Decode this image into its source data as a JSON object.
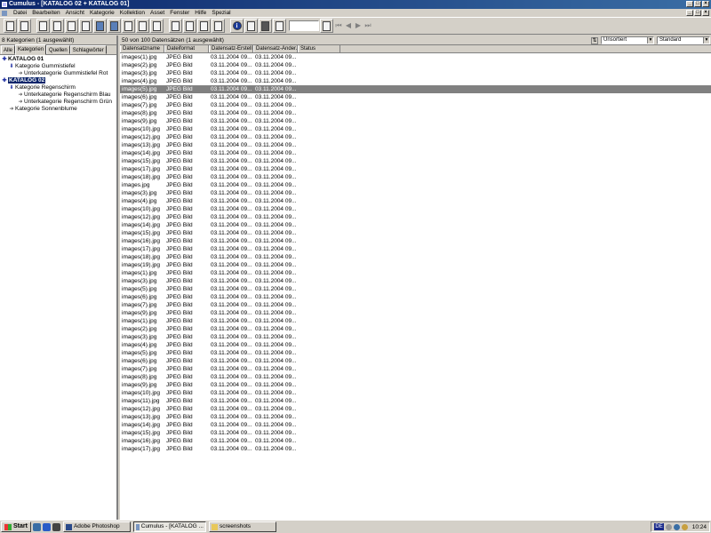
{
  "window": {
    "title": "Cumulus - [KATALOG 02 + KATALOG 01]",
    "controls": [
      "_",
      "□",
      "×"
    ]
  },
  "menubar": {
    "items": [
      "Datei",
      "Bearbeiten",
      "Ansicht",
      "Kategorie",
      "Kollektion",
      "Asset",
      "Fenster",
      "Hilfe",
      "Spezial"
    ]
  },
  "left": {
    "status": "8 Kategorien (1 ausgewählt)",
    "tabs": [
      "Alle",
      "Kategorien",
      "Quellen",
      "Schlagwörter"
    ],
    "active_tab": "Kategorien",
    "tree": [
      {
        "label": "KATALOG 01",
        "level": 0,
        "selected": false
      },
      {
        "label": "Kategorie Gummistiefel",
        "level": 1,
        "selected": false
      },
      {
        "label": "Unterkategorie Gummistiefel Rot",
        "level": 2,
        "selected": false
      },
      {
        "label": "KATALOG 02",
        "level": 0,
        "selected": true
      },
      {
        "label": "Kategorie Regenschirm",
        "level": 1,
        "selected": false
      },
      {
        "label": "Unterkategorie Regenschirm Blau",
        "level": 2,
        "selected": false
      },
      {
        "label": "Unterkategorie Regenschirm Grün",
        "level": 2,
        "selected": false
      },
      {
        "label": "Kategorie Sonnenblume",
        "level": 1,
        "selected": false
      }
    ]
  },
  "right": {
    "status": "50 von 100 Datensätzen (1 ausgewählt)",
    "sort_value": "Unsortiert",
    "view_value": "Standard",
    "columns": [
      "Datensatzname",
      "Dateiformat",
      "Datensatz-Erstell...",
      "Datensatz-Änder...",
      "Status"
    ],
    "rows": [
      [
        "images(1).jpg",
        "JPEG Bild",
        "03.11.2004 09...",
        "03.11.2004 09..."
      ],
      [
        "images(2).jpg",
        "JPEG Bild",
        "03.11.2004 09...",
        "03.11.2004 09..."
      ],
      [
        "images(3).jpg",
        "JPEG Bild",
        "03.11.2004 09...",
        "03.11.2004 09..."
      ],
      [
        "images(4).jpg",
        "JPEG Bild",
        "03.11.2004 09...",
        "03.11.2004 09..."
      ],
      [
        "images(5).jpg",
        "JPEG Bild",
        "03.11.2004 09...",
        "03.11.2004 09..."
      ],
      [
        "images(6).jpg",
        "JPEG Bild",
        "03.11.2004 09...",
        "03.11.2004 09..."
      ],
      [
        "images(7).jpg",
        "JPEG Bild",
        "03.11.2004 09...",
        "03.11.2004 09..."
      ],
      [
        "images(8).jpg",
        "JPEG Bild",
        "03.11.2004 09...",
        "03.11.2004 09..."
      ],
      [
        "images(9).jpg",
        "JPEG Bild",
        "03.11.2004 09...",
        "03.11.2004 09..."
      ],
      [
        "images(10).jpg",
        "JPEG Bild",
        "03.11.2004 09...",
        "03.11.2004 09..."
      ],
      [
        "images(12).jpg",
        "JPEG Bild",
        "03.11.2004 09...",
        "03.11.2004 09..."
      ],
      [
        "images(13).jpg",
        "JPEG Bild",
        "03.11.2004 09...",
        "03.11.2004 09..."
      ],
      [
        "images(14).jpg",
        "JPEG Bild",
        "03.11.2004 09...",
        "03.11.2004 09..."
      ],
      [
        "images(15).jpg",
        "JPEG Bild",
        "03.11.2004 09...",
        "03.11.2004 09..."
      ],
      [
        "images(17).jpg",
        "JPEG Bild",
        "03.11.2004 09...",
        "03.11.2004 09..."
      ],
      [
        "images(18).jpg",
        "JPEG Bild",
        "03.11.2004 09...",
        "03.11.2004 09..."
      ],
      [
        "images.jpg",
        "JPEG Bild",
        "03.11.2004 09...",
        "03.11.2004 09..."
      ],
      [
        "images(3).jpg",
        "JPEG Bild",
        "03.11.2004 09...",
        "03.11.2004 09..."
      ],
      [
        "images(4).jpg",
        "JPEG Bild",
        "03.11.2004 09...",
        "03.11.2004 09..."
      ],
      [
        "images(10).jpg",
        "JPEG Bild",
        "03.11.2004 09...",
        "03.11.2004 09..."
      ],
      [
        "images(12).jpg",
        "JPEG Bild",
        "03.11.2004 09...",
        "03.11.2004 09..."
      ],
      [
        "images(14).jpg",
        "JPEG Bild",
        "03.11.2004 09...",
        "03.11.2004 09..."
      ],
      [
        "images(15).jpg",
        "JPEG Bild",
        "03.11.2004 09...",
        "03.11.2004 09..."
      ],
      [
        "images(16).jpg",
        "JPEG Bild",
        "03.11.2004 09...",
        "03.11.2004 09..."
      ],
      [
        "images(17).jpg",
        "JPEG Bild",
        "03.11.2004 09...",
        "03.11.2004 09..."
      ],
      [
        "images(18).jpg",
        "JPEG Bild",
        "03.11.2004 09...",
        "03.11.2004 09..."
      ],
      [
        "images(19).jpg",
        "JPEG Bild",
        "03.11.2004 09...",
        "03.11.2004 09..."
      ],
      [
        "images(1).jpg",
        "JPEG Bild",
        "03.11.2004 09...",
        "03.11.2004 09..."
      ],
      [
        "images(3).jpg",
        "JPEG Bild",
        "03.11.2004 09...",
        "03.11.2004 09..."
      ],
      [
        "images(5).jpg",
        "JPEG Bild",
        "03.11.2004 09...",
        "03.11.2004 09..."
      ],
      [
        "images(6).jpg",
        "JPEG Bild",
        "03.11.2004 09...",
        "03.11.2004 09..."
      ],
      [
        "images(7).jpg",
        "JPEG Bild",
        "03.11.2004 09...",
        "03.11.2004 09..."
      ],
      [
        "images(9).jpg",
        "JPEG Bild",
        "03.11.2004 09...",
        "03.11.2004 09..."
      ],
      [
        "images(1).jpg",
        "JPEG Bild",
        "03.11.2004 09...",
        "03.11.2004 09..."
      ],
      [
        "images(2).jpg",
        "JPEG Bild",
        "03.11.2004 09...",
        "03.11.2004 09..."
      ],
      [
        "images(3).jpg",
        "JPEG Bild",
        "03.11.2004 09...",
        "03.11.2004 09..."
      ],
      [
        "images(4).jpg",
        "JPEG Bild",
        "03.11.2004 09...",
        "03.11.2004 09..."
      ],
      [
        "images(5).jpg",
        "JPEG Bild",
        "03.11.2004 09...",
        "03.11.2004 09..."
      ],
      [
        "images(6).jpg",
        "JPEG Bild",
        "03.11.2004 09...",
        "03.11.2004 09..."
      ],
      [
        "images(7).jpg",
        "JPEG Bild",
        "03.11.2004 09...",
        "03.11.2004 09..."
      ],
      [
        "images(8).jpg",
        "JPEG Bild",
        "03.11.2004 09...",
        "03.11.2004 09..."
      ],
      [
        "images(9).jpg",
        "JPEG Bild",
        "03.11.2004 09...",
        "03.11.2004 09..."
      ],
      [
        "images(10).jpg",
        "JPEG Bild",
        "03.11.2004 09...",
        "03.11.2004 09..."
      ],
      [
        "images(11).jpg",
        "JPEG Bild",
        "03.11.2004 09...",
        "03.11.2004 09..."
      ],
      [
        "images(12).jpg",
        "JPEG Bild",
        "03.11.2004 09...",
        "03.11.2004 09..."
      ],
      [
        "images(13).jpg",
        "JPEG Bild",
        "03.11.2004 09...",
        "03.11.2004 09..."
      ],
      [
        "images(14).jpg",
        "JPEG Bild",
        "03.11.2004 09...",
        "03.11.2004 09..."
      ],
      [
        "images(15).jpg",
        "JPEG Bild",
        "03.11.2004 09...",
        "03.11.2004 09..."
      ],
      [
        "images(16).jpg",
        "JPEG Bild",
        "03.11.2004 09...",
        "03.11.2004 09..."
      ],
      [
        "images(17).jpg",
        "JPEG Bild",
        "03.11.2004 09...",
        "03.11.2004 09..."
      ]
    ],
    "selected_row": 4
  },
  "taskbar": {
    "start_label": "Start",
    "tasks": [
      {
        "label": "Adobe Photoshop",
        "active": false
      },
      {
        "label": "Cumulus - [KATALOG ...",
        "active": true
      },
      {
        "label": "screenshots",
        "active": false
      }
    ],
    "language": "DE",
    "clock": "10:24"
  },
  "colors": {
    "title_gradient_start": "#0a246a",
    "title_gradient_end": "#3a6ea5",
    "selection_tree": "#0a246a",
    "selection_row": "#808080",
    "chrome": "#d4d0c8"
  }
}
